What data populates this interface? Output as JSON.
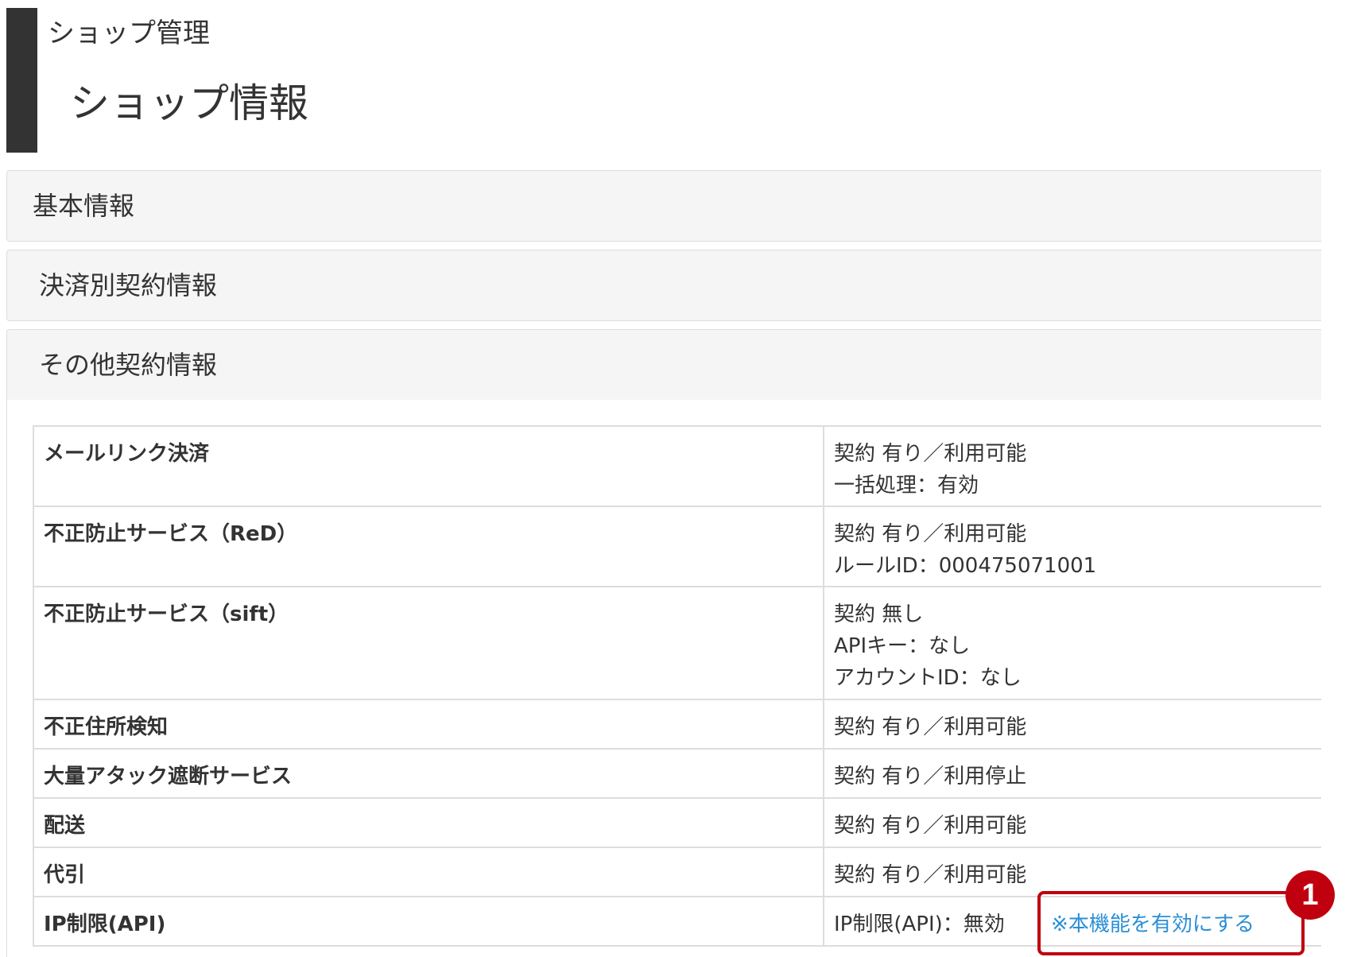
{
  "header": {
    "breadcrumb": "ショップ管理",
    "title": "ショップ情報"
  },
  "panels": [
    {
      "label": "基本情報"
    },
    {
      "label": "決済別契約情報"
    },
    {
      "label": "その他契約情報"
    }
  ],
  "contract_table": {
    "rows": [
      {
        "label": "メールリンク決済",
        "values": [
          "契約 有り／利用可能",
          "一括処理：有効"
        ]
      },
      {
        "label": "不正防止サービス（ReD）",
        "values": [
          "契約 有り／利用可能",
          "ルールID：000475071001"
        ]
      },
      {
        "label": "不正防止サービス（sift）",
        "values": [
          "契約 無し",
          "APIキー：なし",
          "アカウントID：なし"
        ]
      },
      {
        "label": "不正住所検知",
        "values": [
          "契約 有り／利用可能"
        ]
      },
      {
        "label": "大量アタック遮断サービス",
        "values": [
          "契約 有り／利用停止"
        ]
      },
      {
        "label": "配送",
        "values": [
          "契約 有り／利用可能"
        ]
      },
      {
        "label": "代引",
        "values": [
          "契約 有り／利用可能"
        ]
      },
      {
        "label": "IP制限(API)",
        "values": [
          "IP制限(API)：無効"
        ],
        "link": "※本機能を有効にする"
      }
    ]
  },
  "annotation": {
    "badge_number": "1",
    "color": "#c0000f"
  },
  "colors": {
    "header_bar": "#333333",
    "link": "#2a8fd6",
    "panel_bg": "#f5f5f5",
    "border": "#dddddd"
  }
}
